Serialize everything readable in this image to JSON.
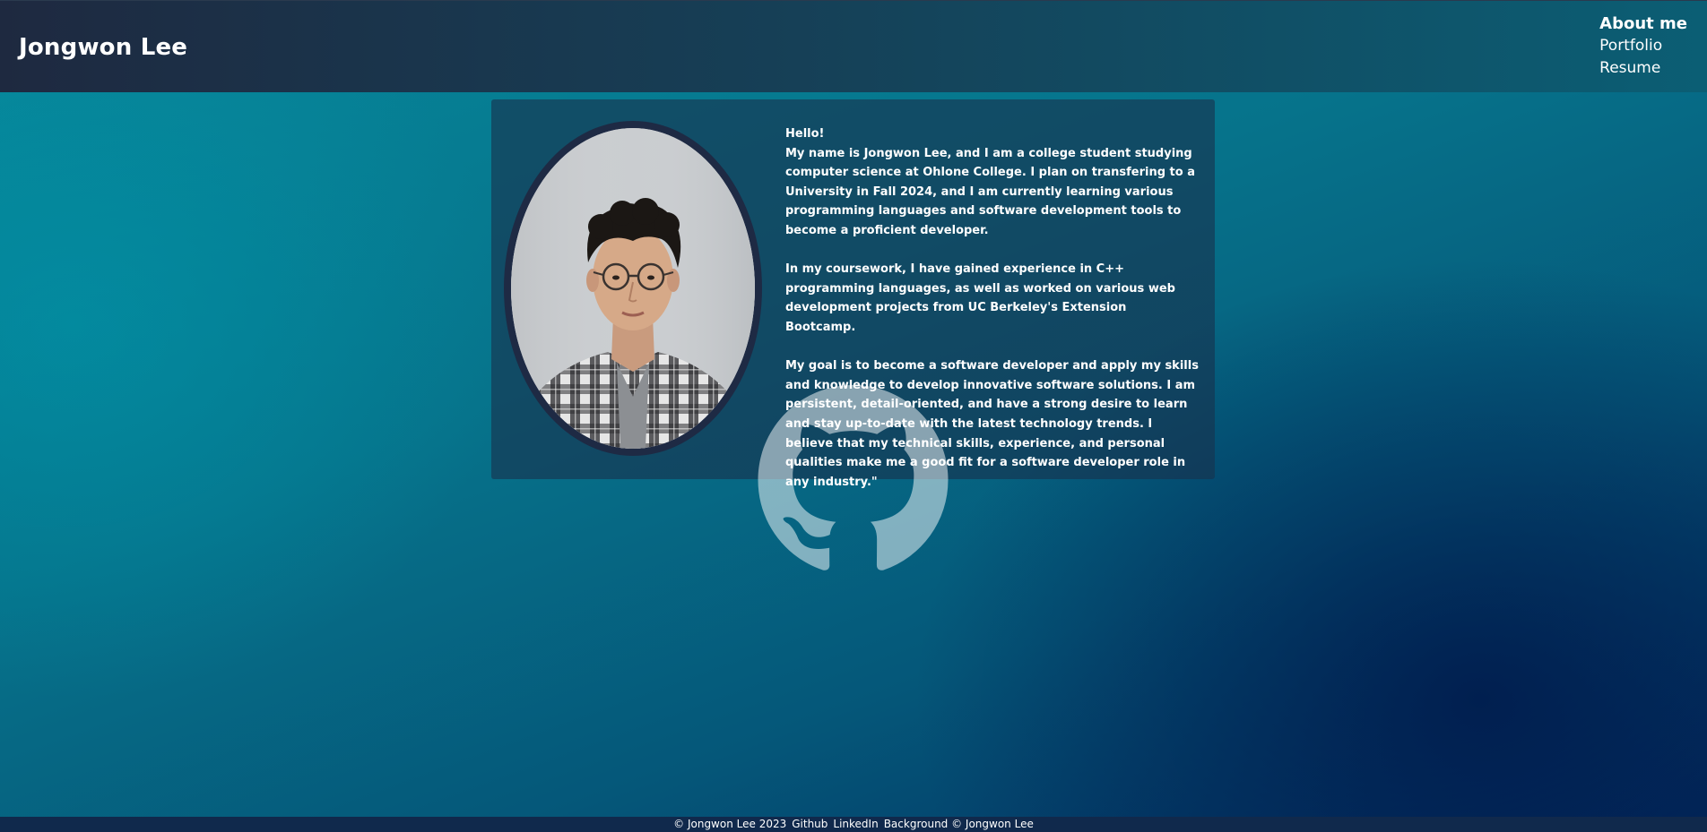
{
  "header": {
    "title": "Jongwon Lee",
    "nav": [
      {
        "label": "About me",
        "active": true
      },
      {
        "label": "Portfolio",
        "active": false
      },
      {
        "label": "Resume",
        "active": false
      }
    ]
  },
  "about": {
    "greeting": "Hello!",
    "paragraph_1": "My name is Jongwon Lee, and I am a college student studying computer science at Ohlone College. I plan on transfering to a University in Fall 2024, and I am currently learning various programming languages and software development tools to become a proficient developer.",
    "paragraph_2": "In my coursework, I have gained experience in C++ programming languages, as well as worked on various web development projects from UC Berkeley's Extension Bootcamp.",
    "paragraph_3": "My goal is to become a software developer and apply my skills and knowledge to develop innovative software solutions. I am persistent, detail-oriented, and have a strong desire to learn and stay up-to-date with the latest technology trends. I believe that my technical skills, experience, and personal qualities make me a good fit for a software developer role in any industry.\""
  },
  "icons": {
    "github": "github-icon",
    "portrait": "profile-photo"
  },
  "footer": {
    "copyright": "© Jongwon Lee 2023",
    "github_link": "Github",
    "linkedin_link": "LinkedIn",
    "background_credit": "Background © Jongwon Lee"
  },
  "colors": {
    "header_dark": "#1e2940",
    "header_teal": "#0b5e74",
    "background_teal": "#07879a",
    "background_navy": "#022a5e",
    "card": "#18324e",
    "portrait_border": "#1e2a44",
    "footer": "#10294c"
  }
}
